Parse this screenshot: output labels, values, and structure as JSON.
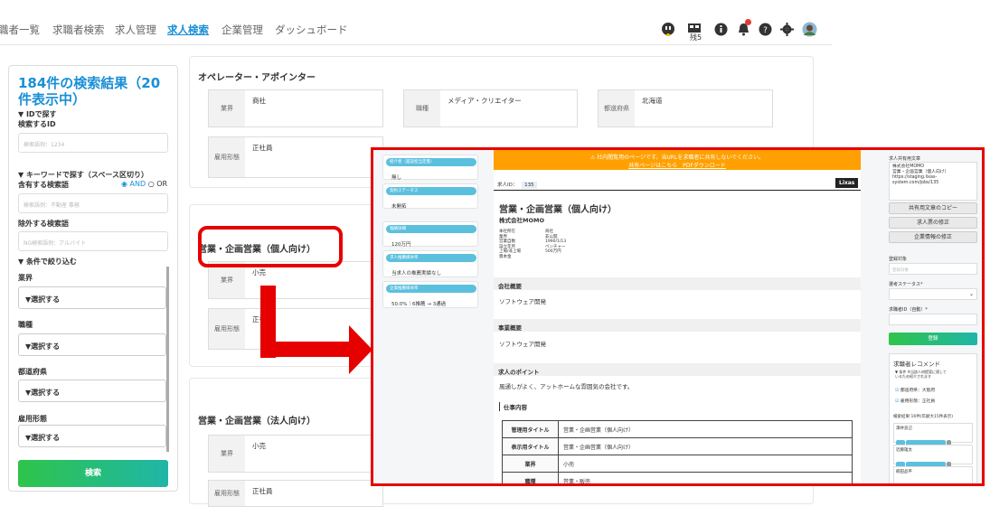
{
  "nav": {
    "items": [
      "職者一覧",
      "求職者検索",
      "求人管理",
      "求人検索",
      "企業管理",
      "ダッシュボード"
    ],
    "active_index": 3,
    "icon_badge_text": "残5"
  },
  "search_panel": {
    "result_title": "184件の検索結果（20件表示中）",
    "id_section": "▼ IDで探す",
    "id_label": "検索するID",
    "id_placeholder": "検索語例：1234",
    "keyword_section": "▼ キーワードで探す（スペース区切り）",
    "include_label": "含有する検索語",
    "and_label": "AND",
    "or_label": "OR",
    "include_placeholder": "検索語例：不動産 事務",
    "exclude_label": "除外する検索語",
    "exclude_placeholder": "NG検索語例：アルバイト",
    "filter_section": "▼ 条件で絞り込む",
    "filters": [
      {
        "label": "業界",
        "value": "▼選択する"
      },
      {
        "label": "職種",
        "value": "▼選択する"
      },
      {
        "label": "都道府県",
        "value": "▼選択する"
      },
      {
        "label": "雇用形態",
        "value": "▼選択する"
      }
    ],
    "search_button": "検索"
  },
  "cards": [
    {
      "title": "オペレーター・アポインター",
      "fields": [
        {
          "label": "業界",
          "value": "商社"
        },
        {
          "label": "職種",
          "value": "メディア・クリエイター"
        },
        {
          "label": "都道府県",
          "value": "北海道"
        },
        {
          "label": "雇用形態",
          "value": "正社員"
        }
      ]
    },
    {
      "title": "営業・企画営業（個人向け）",
      "fields": [
        {
          "label": "業界",
          "value": "小売"
        },
        {
          "label": "雇用形態",
          "value": "正社"
        }
      ]
    },
    {
      "title": "営業・企画営業（法人向け）",
      "fields": [
        {
          "label": "業界",
          "value": "小売"
        },
        {
          "label": "雇用形態",
          "value": "正社員"
        }
      ]
    }
  ],
  "overlay": {
    "left_cards": [
      {
        "tag": "紹介者（面談担当定量）",
        "value": "無し"
      },
      {
        "tag": "契約ステータス",
        "value": "未開拓"
      },
      {
        "tag": "報酬詳細",
        "value": "120万円"
      },
      {
        "tag": "求人推薦媒体率",
        "value": "当求人の推薦実績なし"
      },
      {
        "tag": "企業推薦媒体率",
        "value": "50.0%｜6推薦 → 3通過"
      }
    ],
    "banner_line1": "⚠ 社内閲覧用のページです。当URLを求職者に共有しないでください。",
    "banner_line2": "共有ページはこちら　PDFダウンロード",
    "job_id_label": "求人ID：",
    "job_id": "135",
    "brand": "Lixas",
    "job_title": "営業・企画営業（個人向け）",
    "company": "株式会社MOMO",
    "meta_keys": [
      "本社所在",
      "業界",
      "営業自数",
      "設立年月",
      "上場/非上場",
      "資本金"
    ],
    "meta_values": [
      "",
      "商社",
      "非公開",
      "1990/1/13",
      "ベンチャー",
      "500万円"
    ],
    "sections": [
      {
        "heading": "会社概要",
        "text": "ソフトウェア開発"
      },
      {
        "heading": "事業概要",
        "text": "ソフトウェア開発"
      },
      {
        "heading": "求人のポイント",
        "text": "風通しがよく、アットホームな雰囲気の会社です。"
      }
    ],
    "job_content_heading": "仕事内容",
    "table": [
      {
        "k": "管理用タイトル",
        "v": "営業・企画営業（個人向け）"
      },
      {
        "k": "表示用タイトル",
        "v": "営業・企画営業（個人向け）"
      },
      {
        "k": "業界",
        "v": "小売"
      },
      {
        "k": "職種",
        "v": "営業・販売"
      }
    ],
    "right": {
      "share_label": "求人共有用文章",
      "share_text": [
        "株式会社MOMO",
        "営業・企画営業（個人向け）",
        "https://staging.lixas-",
        "system.com/jobs/135"
      ],
      "buttons": [
        "共有用文章のコピー",
        "求人票の修正",
        "企業情報の修正"
      ],
      "reg_target_label": "登録対象",
      "reg_target_placeholder": "登録対象",
      "status_label": "選考ステータス*",
      "seeker_id_label": "求職者ID（自動）*",
      "register_button": "登録",
      "recommend_title": "求職者レコメンド",
      "recommend_cond": "▼ 条件 ※当該人材提案に適しているため紹介されます",
      "recommend_checks": [
        "都道府県：大阪府",
        "雇用形態：正社員"
      ],
      "recommend_result": "検索結果:16件(年齢大15件表示)",
      "candidates": [
        "澤井良己",
        "近藤雄太",
        "楠田品平"
      ]
    }
  }
}
